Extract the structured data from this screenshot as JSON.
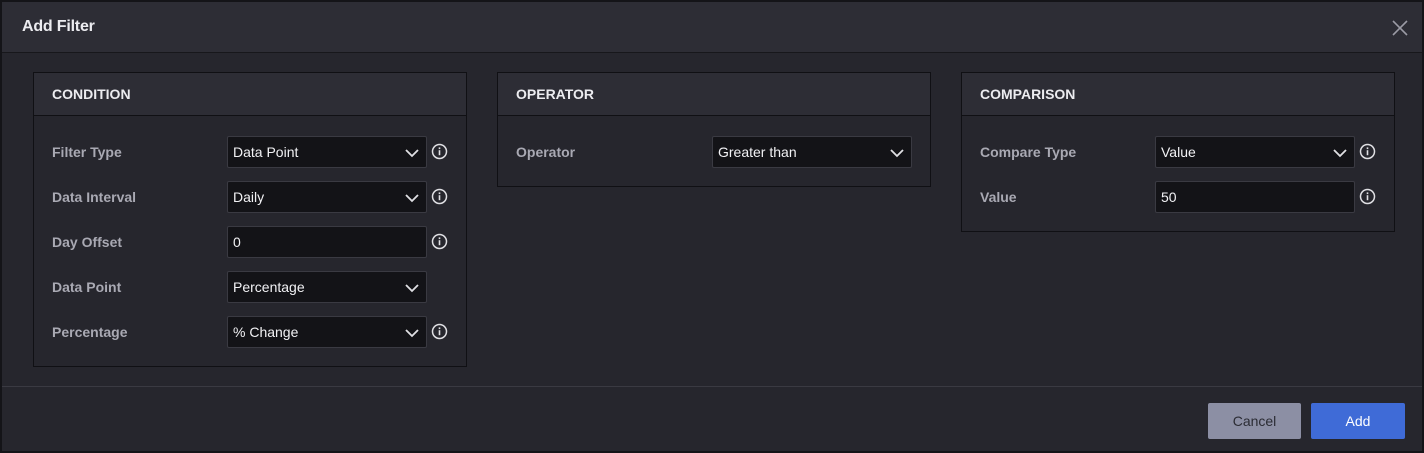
{
  "dialog": {
    "title": "Add Filter"
  },
  "condition": {
    "heading": "CONDITION",
    "rows": [
      {
        "label": "Filter Type",
        "value": "Data Point"
      },
      {
        "label": "Data Interval",
        "value": "Daily"
      },
      {
        "label": "Day Offset",
        "value": "0"
      },
      {
        "label": "Data Point",
        "value": "Percentage"
      },
      {
        "label": "Percentage",
        "value": "% Change"
      }
    ]
  },
  "operator": {
    "heading": "OPERATOR",
    "rows": [
      {
        "label": "Operator",
        "value": "Greater than"
      }
    ]
  },
  "comparison": {
    "heading": "COMPARISON",
    "rows": [
      {
        "label": "Compare Type",
        "value": "Value"
      },
      {
        "label": "Value",
        "value": "50"
      }
    ]
  },
  "footer": {
    "cancel_label": "Cancel",
    "add_label": "Add"
  },
  "colors": {
    "accent": "#3f6bd7",
    "cancel": "#8c8fa4",
    "background": "#26262d"
  }
}
